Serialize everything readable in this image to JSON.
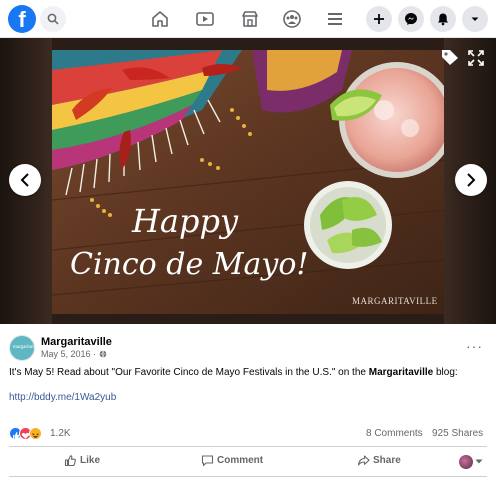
{
  "post": {
    "page_name": "Margaritaville",
    "date": "May 5, 2016 · ",
    "text_before": "It's May 5! Read about \"Our Favorite Cinco de Mayo Festivals in the U.S.\" on the ",
    "text_bold": "Margaritaville",
    "text_after": " blog:",
    "link": "http://bddy.me/1Wa2yub",
    "avatar_text": "margaritaville"
  },
  "image": {
    "line1": "Happy",
    "line2": "Cinco de Mayo!",
    "watermark": "MARGARITAVILLE"
  },
  "stats": {
    "reactions": "1.2K",
    "comments": "8 Comments",
    "shares": "925 Shares"
  },
  "actions": {
    "like": "Like",
    "comment": "Comment",
    "share": "Share"
  },
  "colors": {
    "brand": "#1877f2",
    "link": "#385898",
    "like": "#2078f4",
    "love": "#f33e58",
    "haha": "#f7b125"
  }
}
